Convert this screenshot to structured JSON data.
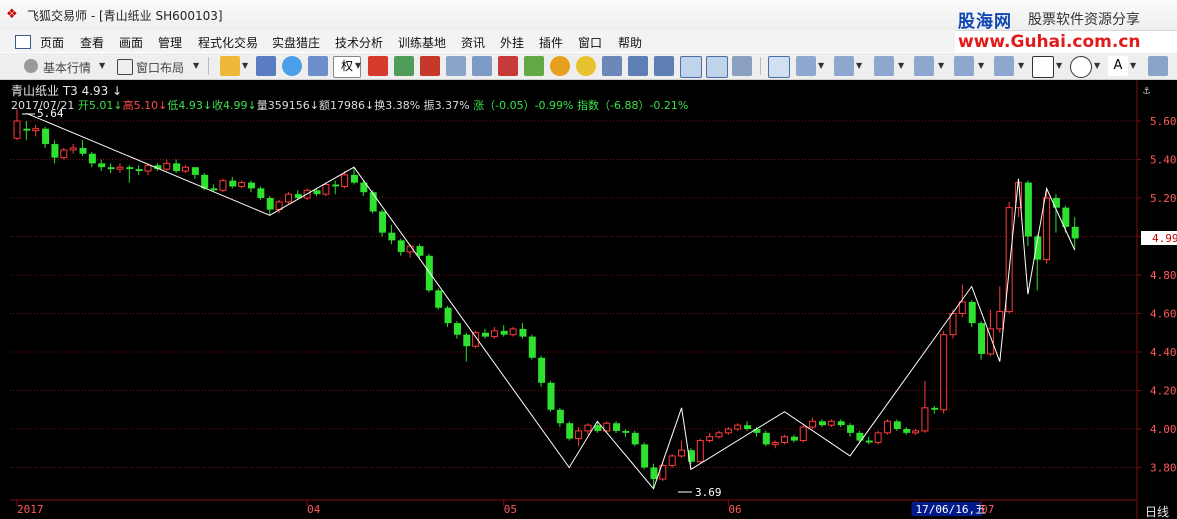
{
  "window": {
    "title": "飞狐交易师 - [青山纸业 SH600103]",
    "brand_cn": "股海网",
    "brand_slogan": "股票软件资源分享",
    "brand_url": "www.Guhai.com.cn"
  },
  "menu": [
    "页面",
    "查看",
    "画面",
    "管理",
    "程式化交易",
    "实盘猎庄",
    "技术分析",
    "训练基地",
    "资讯",
    "外挂",
    "插件",
    "窗口",
    "帮助"
  ],
  "toolbar": {
    "basic_quote": "基本行情",
    "window_layout": "窗口布局",
    "quan": "权"
  },
  "chart_header": {
    "stock_title": "青山纸业  T3  4.93 ↓",
    "date": "2017/07/21",
    "open": "开5.01↓",
    "high": "高5.10↓",
    "low": "低4.93↓",
    "close": "收4.99↓",
    "volume": "量359156↓",
    "amount": "额17986↓",
    "turnover": "换3.38%",
    "amplitude": "振3.37%",
    "change": "涨（-0.05）-0.99%",
    "index_change": "指数（-6.88）-0.21%"
  },
  "price_axis": [
    "5.60",
    "5.40",
    "5.20",
    "5.00",
    "4.80",
    "4.60",
    "4.40",
    "4.20",
    "4.00",
    "3.80"
  ],
  "date_axis": [
    "2017",
    "04",
    "05",
    "06",
    "17/06/16,五",
    "07"
  ],
  "period": "日线",
  "current_price": "4.99",
  "annotations": {
    "high": "5.64",
    "low": "3.69"
  },
  "colors": {
    "up": "#ff3b3b",
    "down": "#2fe12f",
    "zigzag": "#ffffff",
    "grid": "#7a1010",
    "axis": "#7a1010"
  },
  "chart_data": {
    "type": "candlestick",
    "ylim": [
      3.7,
      5.7
    ],
    "candles": [
      [
        5.51,
        5.6,
        5.66,
        5.5
      ],
      [
        5.56,
        5.55,
        5.6,
        5.5
      ],
      [
        5.55,
        5.56,
        5.58,
        5.52
      ],
      [
        5.56,
        5.48,
        5.57,
        5.46
      ],
      [
        5.48,
        5.41,
        5.5,
        5.38
      ],
      [
        5.41,
        5.45,
        5.46,
        5.4
      ],
      [
        5.45,
        5.46,
        5.48,
        5.43
      ],
      [
        5.46,
        5.43,
        5.5,
        5.42
      ],
      [
        5.43,
        5.38,
        5.44,
        5.36
      ],
      [
        5.38,
        5.36,
        5.4,
        5.34
      ],
      [
        5.36,
        5.35,
        5.38,
        5.33
      ],
      [
        5.35,
        5.36,
        5.38,
        5.33
      ],
      [
        5.36,
        5.35,
        5.37,
        5.28
      ],
      [
        5.35,
        5.34,
        5.37,
        5.32
      ],
      [
        5.34,
        5.37,
        5.38,
        5.32
      ],
      [
        5.37,
        5.35,
        5.38,
        5.34
      ],
      [
        5.35,
        5.38,
        5.4,
        5.34
      ],
      [
        5.38,
        5.34,
        5.4,
        5.33
      ],
      [
        5.34,
        5.36,
        5.37,
        5.33
      ],
      [
        5.36,
        5.32,
        5.36,
        5.3
      ],
      [
        5.32,
        5.25,
        5.33,
        5.24
      ],
      [
        5.25,
        5.24,
        5.27,
        5.23
      ],
      [
        5.24,
        5.29,
        5.3,
        5.23
      ],
      [
        5.29,
        5.26,
        5.31,
        5.25
      ],
      [
        5.26,
        5.28,
        5.29,
        5.25
      ],
      [
        5.28,
        5.25,
        5.29,
        5.23
      ],
      [
        5.25,
        5.2,
        5.26,
        5.19
      ],
      [
        5.2,
        5.14,
        5.21,
        5.11
      ],
      [
        5.14,
        5.18,
        5.19,
        5.12
      ],
      [
        5.18,
        5.22,
        5.23,
        5.17
      ],
      [
        5.22,
        5.2,
        5.24,
        5.19
      ],
      [
        5.2,
        5.24,
        5.25,
        5.19
      ],
      [
        5.24,
        5.22,
        5.25,
        5.21
      ],
      [
        5.22,
        5.27,
        5.28,
        5.21
      ],
      [
        5.27,
        5.26,
        5.29,
        5.22
      ],
      [
        5.26,
        5.32,
        5.34,
        5.25
      ],
      [
        5.32,
        5.28,
        5.36,
        5.27
      ],
      [
        5.28,
        5.23,
        5.29,
        5.21
      ],
      [
        5.23,
        5.13,
        5.24,
        5.12
      ],
      [
        5.13,
        5.02,
        5.14,
        5.0
      ],
      [
        5.02,
        4.98,
        5.06,
        4.96
      ],
      [
        4.98,
        4.92,
        4.99,
        4.9
      ],
      [
        4.92,
        4.95,
        4.96,
        4.89
      ],
      [
        4.95,
        4.9,
        4.96,
        4.88
      ],
      [
        4.9,
        4.72,
        4.91,
        4.71
      ],
      [
        4.72,
        4.63,
        4.73,
        4.62
      ],
      [
        4.63,
        4.55,
        4.64,
        4.53
      ],
      [
        4.55,
        4.49,
        4.56,
        4.47
      ],
      [
        4.49,
        4.43,
        4.5,
        4.35
      ],
      [
        4.43,
        4.5,
        4.51,
        4.42
      ],
      [
        4.5,
        4.48,
        4.52,
        4.47
      ],
      [
        4.48,
        4.51,
        4.53,
        4.47
      ],
      [
        4.51,
        4.49,
        4.54,
        4.48
      ],
      [
        4.49,
        4.52,
        4.53,
        4.48
      ],
      [
        4.52,
        4.48,
        4.55,
        4.47
      ],
      [
        4.48,
        4.37,
        4.49,
        4.36
      ],
      [
        4.37,
        4.24,
        4.38,
        4.22
      ],
      [
        4.24,
        4.1,
        4.25,
        4.09
      ],
      [
        4.1,
        4.03,
        4.11,
        4.01
      ],
      [
        4.03,
        3.95,
        4.04,
        3.94
      ],
      [
        3.95,
        3.99,
        4.01,
        3.91
      ],
      [
        3.99,
        4.02,
        4.03,
        3.97
      ],
      [
        4.02,
        3.99,
        4.04,
        3.98
      ],
      [
        3.99,
        4.03,
        4.04,
        3.98
      ],
      [
        4.03,
        3.99,
        4.04,
        3.98
      ],
      [
        3.99,
        3.98,
        4.0,
        3.96
      ],
      [
        3.98,
        3.92,
        3.99,
        3.91
      ],
      [
        3.92,
        3.8,
        3.93,
        3.79
      ],
      [
        3.8,
        3.74,
        3.82,
        3.69
      ],
      [
        3.74,
        3.81,
        3.82,
        3.73
      ],
      [
        3.81,
        3.86,
        3.87,
        3.8
      ],
      [
        3.86,
        3.89,
        3.94,
        3.85
      ],
      [
        3.89,
        3.83,
        3.9,
        3.82
      ],
      [
        3.83,
        3.94,
        3.95,
        3.82
      ],
      [
        3.94,
        3.96,
        3.98,
        3.93
      ],
      [
        3.96,
        3.98,
        3.99,
        3.95
      ],
      [
        3.98,
        4.0,
        4.01,
        3.97
      ],
      [
        4.0,
        4.02,
        4.03,
        3.99
      ],
      [
        4.02,
        4.0,
        4.04,
        3.99
      ],
      [
        4.0,
        3.98,
        4.01,
        3.96
      ],
      [
        3.98,
        3.92,
        3.99,
        3.91
      ],
      [
        3.92,
        3.93,
        3.94,
        3.9
      ],
      [
        3.93,
        3.96,
        3.97,
        3.92
      ],
      [
        3.96,
        3.94,
        3.97,
        3.93
      ],
      [
        3.94,
        4.01,
        4.02,
        3.93
      ],
      [
        4.01,
        4.04,
        4.06,
        4.0
      ],
      [
        4.04,
        4.02,
        4.05,
        4.01
      ],
      [
        4.02,
        4.04,
        4.05,
        4.01
      ],
      [
        4.04,
        4.02,
        4.05,
        4.01
      ],
      [
        4.02,
        3.98,
        4.03,
        3.96
      ],
      [
        3.98,
        3.94,
        3.99,
        3.93
      ],
      [
        3.94,
        3.93,
        3.96,
        3.92
      ],
      [
        3.93,
        3.98,
        3.99,
        3.92
      ],
      [
        3.98,
        4.04,
        4.05,
        3.97
      ],
      [
        4.04,
        4.0,
        4.05,
        3.99
      ],
      [
        4.0,
        3.98,
        4.01,
        3.97
      ],
      [
        3.98,
        3.99,
        4.0,
        3.97
      ],
      [
        3.99,
        4.11,
        4.25,
        3.98
      ],
      [
        4.11,
        4.1,
        4.12,
        4.08
      ],
      [
        4.1,
        4.49,
        4.51,
        4.08
      ],
      [
        4.49,
        4.6,
        4.62,
        4.47
      ],
      [
        4.6,
        4.66,
        4.75,
        4.58
      ],
      [
        4.66,
        4.55,
        4.67,
        4.53
      ],
      [
        4.55,
        4.39,
        4.56,
        4.36
      ],
      [
        4.39,
        4.52,
        4.62,
        4.38
      ],
      [
        4.52,
        4.61,
        4.74,
        4.5
      ],
      [
        4.61,
        5.15,
        5.18,
        4.6
      ],
      [
        5.15,
        5.28,
        5.3,
        5.1
      ],
      [
        5.28,
        5.0,
        5.29,
        4.95
      ],
      [
        5.0,
        4.88,
        5.01,
        4.72
      ],
      [
        4.88,
        5.2,
        5.25,
        4.86
      ],
      [
        5.2,
        5.15,
        5.22,
        5.02
      ],
      [
        5.15,
        5.05,
        5.16,
        5.02
      ],
      [
        5.05,
        4.99,
        5.1,
        4.93
      ]
    ],
    "zigzag": [
      [
        1,
        5.64
      ],
      [
        27,
        5.11
      ],
      [
        36,
        5.36
      ],
      [
        59,
        3.8
      ],
      [
        62,
        4.04
      ],
      [
        68,
        3.69
      ],
      [
        71,
        4.11
      ],
      [
        72,
        3.79
      ],
      [
        82,
        4.09
      ],
      [
        89,
        3.86
      ],
      [
        102,
        4.74
      ],
      [
        105,
        4.35
      ],
      [
        107,
        5.3
      ],
      [
        108,
        4.7
      ],
      [
        110,
        5.25
      ],
      [
        113,
        4.93
      ]
    ]
  }
}
